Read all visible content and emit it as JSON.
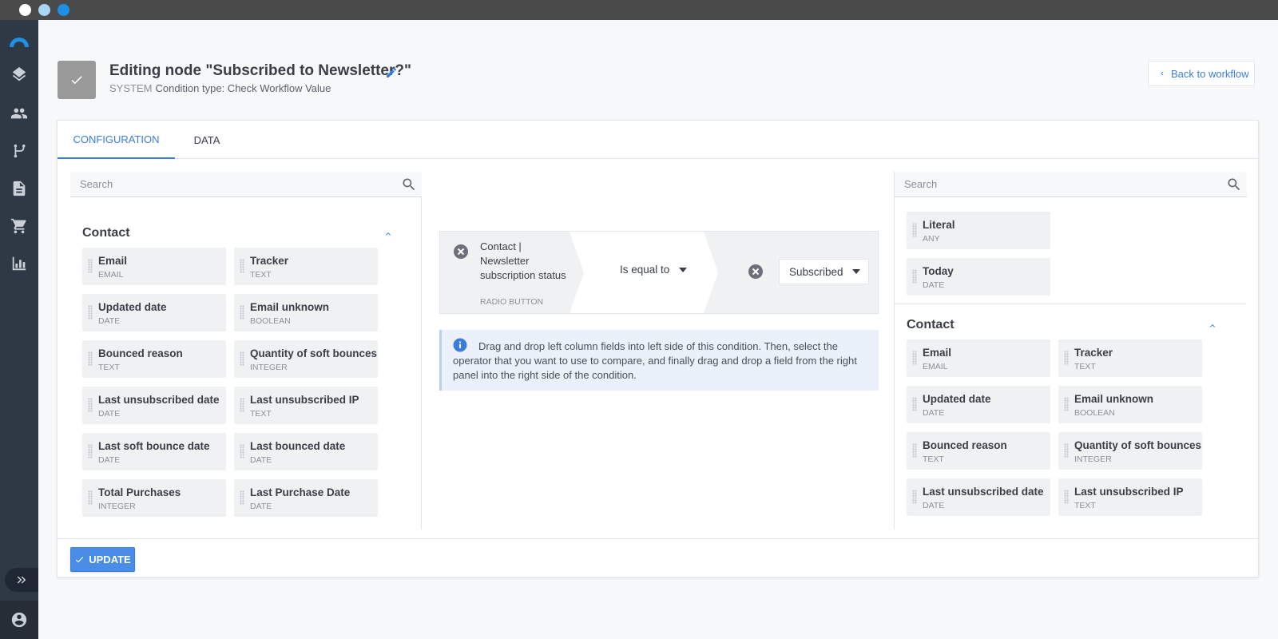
{
  "window": {
    "controls": [
      "close",
      "minimize",
      "maximize"
    ]
  },
  "sidebar": {
    "items": [
      {
        "icon": "logo-icon"
      },
      {
        "icon": "layers-icon"
      },
      {
        "icon": "people-icon"
      },
      {
        "icon": "workflow-icon"
      },
      {
        "icon": "document-icon"
      },
      {
        "icon": "cart-icon"
      },
      {
        "icon": "chart-icon"
      }
    ],
    "expand_icon": "double-chevron-right-icon",
    "user_icon": "account-icon"
  },
  "header": {
    "title": "Editing node \"Subscribed to Newsletter?\"",
    "system_label": "SYSTEM",
    "condition_type": "Condition type: Check Workflow Value",
    "back_label": "Back to workflow"
  },
  "tabs": [
    {
      "label": "CONFIGURATION",
      "active": true
    },
    {
      "label": "DATA",
      "active": false
    }
  ],
  "left_panel": {
    "search_placeholder": "Search",
    "section_title": "Contact",
    "fields": [
      {
        "name": "Email",
        "type": "EMAIL"
      },
      {
        "name": "Tracker",
        "type": "TEXT"
      },
      {
        "name": "Updated date",
        "type": "DATE"
      },
      {
        "name": "Email unknown",
        "type": "BOOLEAN"
      },
      {
        "name": "Bounced reason",
        "type": "TEXT"
      },
      {
        "name": "Quantity of soft bounces",
        "type": "INTEGER"
      },
      {
        "name": "Last unsubscribed date",
        "type": "DATE"
      },
      {
        "name": "Last unsubscribed IP",
        "type": "TEXT"
      },
      {
        "name": "Last soft bounce date",
        "type": "DATE"
      },
      {
        "name": "Last bounced date",
        "type": "DATE"
      },
      {
        "name": "Total Purchases",
        "type": "INTEGER"
      },
      {
        "name": "Last Purchase Date",
        "type": "DATE"
      }
    ]
  },
  "condition": {
    "left_field": "Contact | Newsletter subscription status",
    "left_type": "RADIO BUTTON",
    "operator": "Is equal to",
    "value": "Subscribed"
  },
  "info_text": "Drag and drop left column fields into left side of this condition. Then, select the operator that you want to use to compare, and finally drag and drop a field from the right panel into the right side of the condition.",
  "right_panel": {
    "search_placeholder": "Search",
    "special_fields": [
      {
        "name": "Literal",
        "type": "ANY"
      },
      {
        "name": "Today",
        "type": "DATE"
      }
    ],
    "section_title": "Contact",
    "fields": [
      {
        "name": "Email",
        "type": "EMAIL"
      },
      {
        "name": "Tracker",
        "type": "TEXT"
      },
      {
        "name": "Updated date",
        "type": "DATE"
      },
      {
        "name": "Email unknown",
        "type": "BOOLEAN"
      },
      {
        "name": "Bounced reason",
        "type": "TEXT"
      },
      {
        "name": "Quantity of soft bounces",
        "type": "INTEGER"
      },
      {
        "name": "Last unsubscribed date",
        "type": "DATE"
      },
      {
        "name": "Last unsubscribed IP",
        "type": "TEXT"
      }
    ]
  },
  "footer": {
    "update_label": "UPDATE"
  },
  "colors": {
    "accent": "#3b7ddd",
    "sidebar": "#2f3945",
    "titlebar": "#4a4a4a",
    "field_bg": "#f0f1f3"
  }
}
